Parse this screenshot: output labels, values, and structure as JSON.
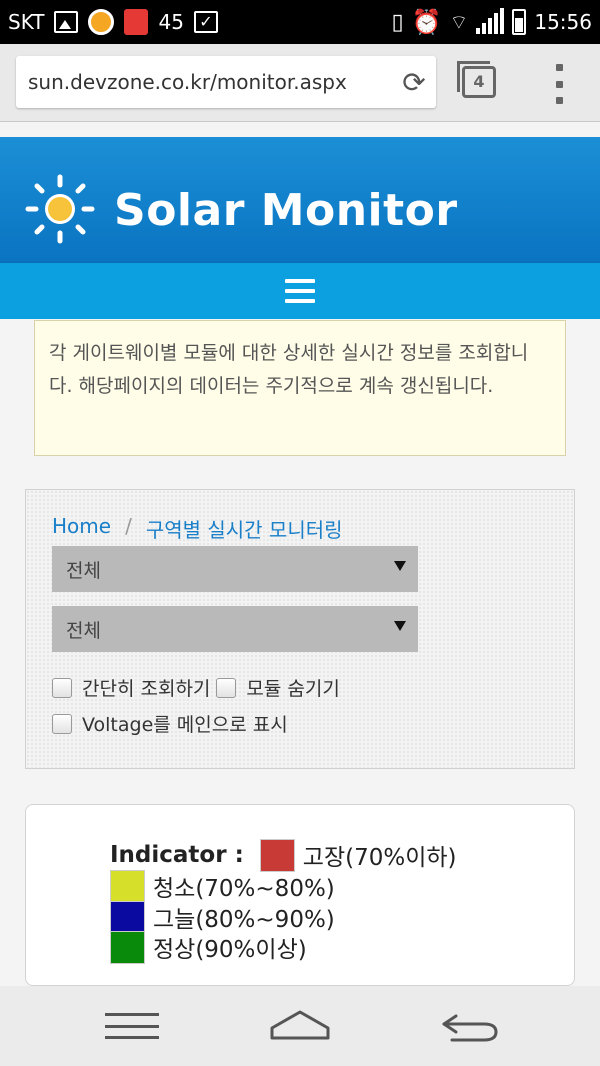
{
  "status_bar": {
    "carrier": "SKT",
    "notification_count": "45",
    "time": "15:56",
    "icons": [
      "image-icon",
      "orange-circle-icon",
      "red-app-icon",
      "check-icon",
      "vibrate-icon",
      "alarm-icon",
      "wifi-icon",
      "signal-icon",
      "battery-icon"
    ]
  },
  "browser": {
    "url": "sun.devzone.co.kr/monitor.aspx",
    "tab_count": "4"
  },
  "header": {
    "title": "Solar Monitor"
  },
  "notice": {
    "text": "  각 게이트웨이별 모듈에 대한 상세한 실시간 정보를 조회합니다. 해당페이지의 데이터는 주기적으로 계속 갱신됩니다."
  },
  "filters": {
    "breadcrumb_home": "Home",
    "breadcrumb_sep": "/",
    "breadcrumb_current": "구역별 실시간 모니터링",
    "select1_value": "전체",
    "select2_value": "전체",
    "checkbox_simple": "간단히 조회하기",
    "checkbox_hide_module": "모듈 숨기기",
    "checkbox_voltage": "Voltage를 메인으로 표시"
  },
  "indicator": {
    "title": "Indicator :",
    "items": [
      {
        "label": "고장(70%이하)",
        "color": "#c83a35"
      },
      {
        "label": "청소(70%~80%)",
        "color": "#d6e02a"
      },
      {
        "label": "그늘(80%~90%)",
        "color": "#0a0aa0"
      },
      {
        "label": "정상(90%이상)",
        "color": "#0a8a0a"
      }
    ]
  }
}
